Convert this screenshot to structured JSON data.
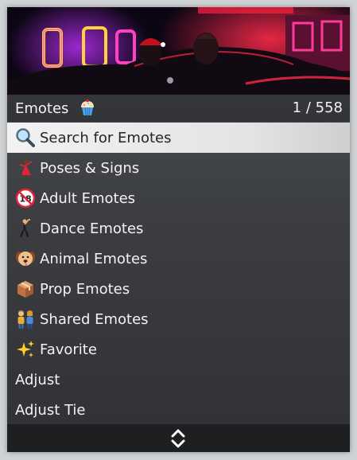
{
  "banner": {
    "image": "neon-nightclub-scene"
  },
  "subheader": {
    "title": "Emotes",
    "title_icon": "cupcake-icon",
    "counter": "1 / 558"
  },
  "items": [
    {
      "label": "Search for Emotes",
      "icon": "magnifier-icon",
      "selected": true
    },
    {
      "label": "Poses & Signs",
      "icon": "dancer-icon"
    },
    {
      "label": "Adult Emotes",
      "icon": "no-under-18-icon"
    },
    {
      "label": "Dance Emotes",
      "icon": "man-dancing-icon"
    },
    {
      "label": "Animal Emotes",
      "icon": "dog-face-icon"
    },
    {
      "label": "Prop Emotes",
      "icon": "package-icon"
    },
    {
      "label": "Shared Emotes",
      "icon": "couple-icon"
    },
    {
      "label": "Favorite",
      "icon": "sparkles-icon"
    },
    {
      "label": "Adjust"
    },
    {
      "label": "Adjust Tie"
    }
  ],
  "footer": {
    "icon": "up-down-arrows-icon"
  },
  "colors": {
    "selected_bg": "#ececec",
    "menu_bg": "#3c3e42",
    "footer_bg": "#1e1f21",
    "text": "#f3f3f3"
  }
}
